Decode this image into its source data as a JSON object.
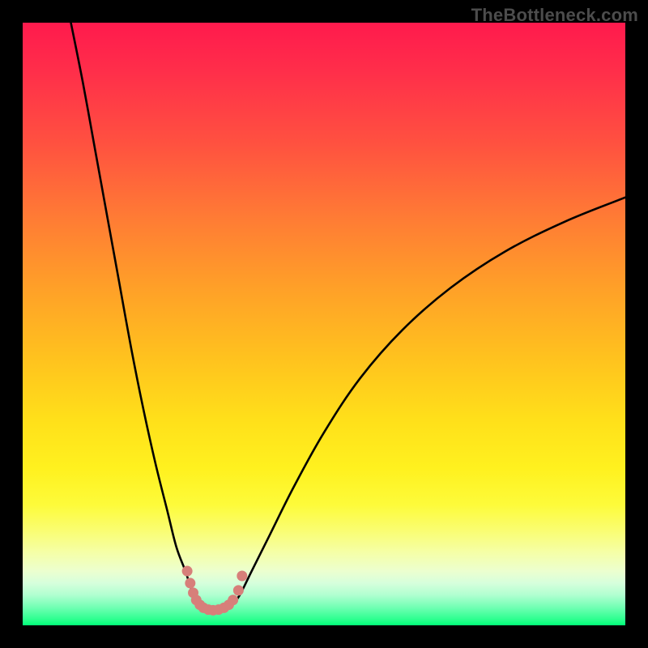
{
  "watermark": "TheBottleneck.com",
  "colors": {
    "frame": "#000000",
    "curve": "#000000",
    "marker": "#d77f7a",
    "gradient_top": "#ff1a4d",
    "gradient_bottom": "#00ff78"
  },
  "chart_data": {
    "type": "line",
    "title": "",
    "xlabel": "",
    "ylabel": "",
    "xlim": [
      0,
      100
    ],
    "ylim": [
      0,
      100
    ],
    "grid": false,
    "legend": false,
    "note": "No numeric axis ticks or labels are rendered in the image; x/y ranges are nominal 0–100. Values are estimated from pixel positions.",
    "series": [
      {
        "name": "left-curve",
        "x": [
          8,
          10,
          12,
          14,
          16,
          18,
          20,
          22,
          24,
          25.5,
          27,
          28,
          29,
          29.8
        ],
        "y": [
          100,
          90,
          79,
          68,
          57,
          46,
          36,
          27,
          19,
          13,
          9,
          6,
          4,
          3
        ]
      },
      {
        "name": "right-curve",
        "x": [
          34.5,
          36,
          38,
          41,
          45,
          50,
          56,
          63,
          71,
          80,
          90,
          100
        ],
        "y": [
          3,
          5,
          9,
          15,
          23,
          32,
          41,
          49,
          56,
          62,
          67,
          71
        ]
      },
      {
        "name": "marker-cluster",
        "style": "scatter",
        "note": "Pink dotted segment near the trough",
        "x": [
          27.3,
          27.8,
          28.3,
          28.8,
          29.4,
          30.0,
          30.8,
          31.6,
          32.5,
          33.4,
          34.2,
          34.9,
          35.8,
          36.4
        ],
        "y": [
          9.0,
          7.0,
          5.4,
          4.2,
          3.4,
          2.9,
          2.6,
          2.5,
          2.6,
          2.9,
          3.4,
          4.2,
          5.8,
          8.2
        ]
      }
    ]
  }
}
